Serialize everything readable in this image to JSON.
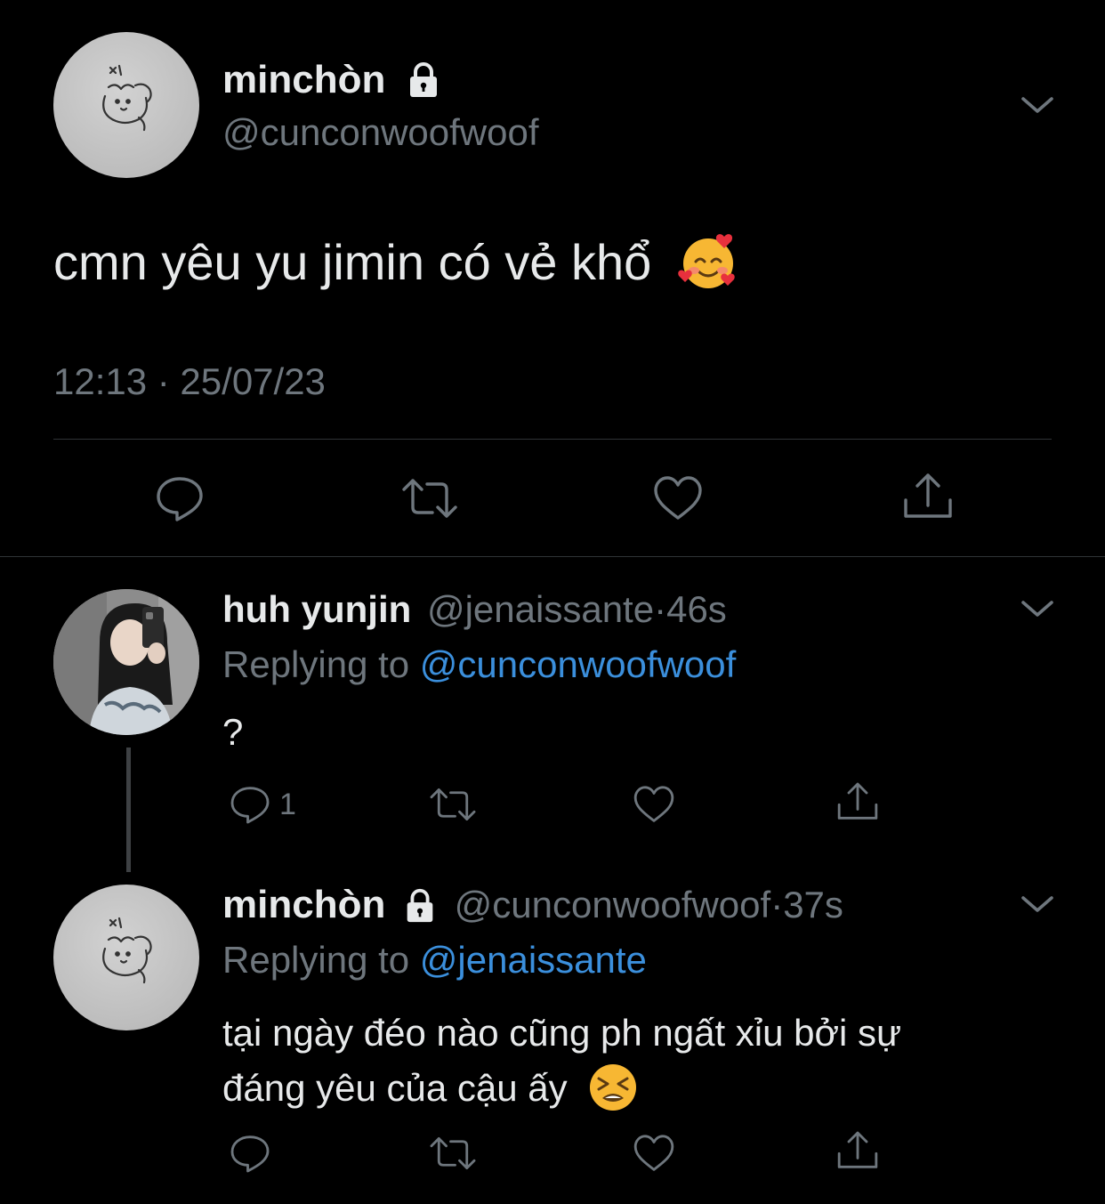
{
  "main_tweet": {
    "display_name": "minchòn",
    "handle": "@cunconwoofwoof",
    "text": "cmn yêu yu jimin có vẻ khổ",
    "timestamp": "12:13 · 25/07/23",
    "locked": true
  },
  "replies": [
    {
      "display_name": "huh yunjin",
      "handle": "@jenaissante",
      "sep": "·",
      "age": "46s",
      "replying_label": "Replying to",
      "replying_to": "@cunconwoofwoof",
      "text": "?",
      "reply_count": "1"
    },
    {
      "display_name": "minchòn",
      "handle": "@cunconwoofwoof",
      "sep": "·",
      "age": "37s",
      "replying_label": "Replying to",
      "replying_to": "@jenaissante",
      "text_line1": "tại ngày đéo nào cũng ph ngất xỉu bởi sự",
      "text_line2": "đáng yêu của cậu ấy",
      "locked": true
    }
  ],
  "colors": {
    "background": "#000000",
    "text": "#e7e9ea",
    "muted": "#6e767d",
    "link": "#3b8fdc",
    "divider": "#2f3336"
  },
  "icons": [
    "lock-icon",
    "chevron-down-icon",
    "reply-icon",
    "retweet-icon",
    "like-icon",
    "share-icon",
    "smiling-face-with-hearts-emoji",
    "tired-face-emoji"
  ]
}
